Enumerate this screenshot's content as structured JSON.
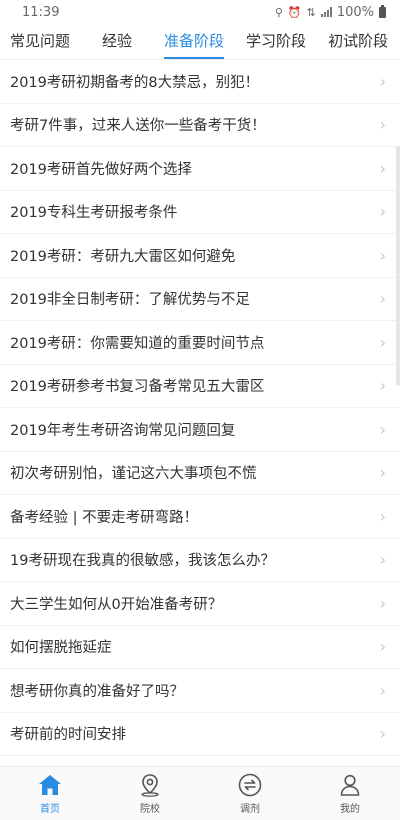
{
  "status_bar": {
    "time": "11:39",
    "battery_text": "100%"
  },
  "tabs": [
    {
      "label": "常见问题",
      "active": false
    },
    {
      "label": "经验",
      "active": false
    },
    {
      "label": "准备阶段",
      "active": true
    },
    {
      "label": "学习阶段",
      "active": false
    },
    {
      "label": "初试阶段",
      "active": false
    }
  ],
  "articles": [
    "2019考研初期备考的8大禁忌，别犯！",
    "考研7件事，过来人送你一些备考干货！",
    "2019考研首先做好两个选择",
    "2019专科生考研报考条件",
    "2019考研：考研九大雷区如何避免",
    "2019非全日制考研：了解优势与不足",
    "2019考研：你需要知道的重要时间节点",
    "2019考研参考书复习备考常见五大雷区",
    "2019年考生考研咨询常见问题回复",
    "初次考研别怕，谨记这六大事项包不慌",
    "备考经验 | 不要走考研弯路！",
    "19考研现在我真的很敏感，我该怎么办？",
    "大三学生如何从0开始准备考研？",
    "如何摆脱拖延症",
    "想考研你真的准备好了吗？",
    "考研前的时间安排"
  ],
  "bottom_nav": [
    {
      "label": "首页",
      "icon": "home-icon",
      "active": true
    },
    {
      "label": "院校",
      "icon": "location-pin-icon",
      "active": false
    },
    {
      "label": "调剂",
      "icon": "swap-icon",
      "active": false
    },
    {
      "label": "我的",
      "icon": "person-icon",
      "active": false
    }
  ],
  "colors": {
    "accent": "#2c8be0",
    "text": "#333333",
    "chevron": "#c8c8c8"
  }
}
